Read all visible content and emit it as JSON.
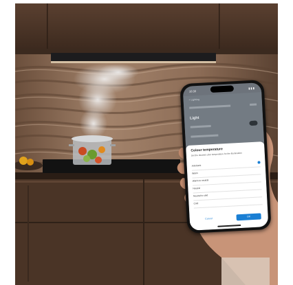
{
  "phone": {
    "time": "10:30",
    "signal": "▮▮▮",
    "back_label": "< Lighting",
    "section_header": "Light",
    "sheet": {
      "title": "Colour temperature",
      "description": "Set the desired color temperature for the illumination",
      "options": [
        {
          "label": "Anti-back",
          "selected": true
        },
        {
          "label": "Warm",
          "selected": false
        },
        {
          "label": "Warm to neutral",
          "selected": false
        },
        {
          "label": "Neutral",
          "selected": false
        },
        {
          "label": "Neutral to cold",
          "selected": false
        },
        {
          "label": "Cold",
          "selected": false
        }
      ],
      "cancel_label": "Cancel",
      "ok_label": "OK"
    }
  },
  "colors": {
    "cabinet": "#4a3425",
    "wall": "#8a6b55",
    "accent": "#1a7fd4"
  }
}
